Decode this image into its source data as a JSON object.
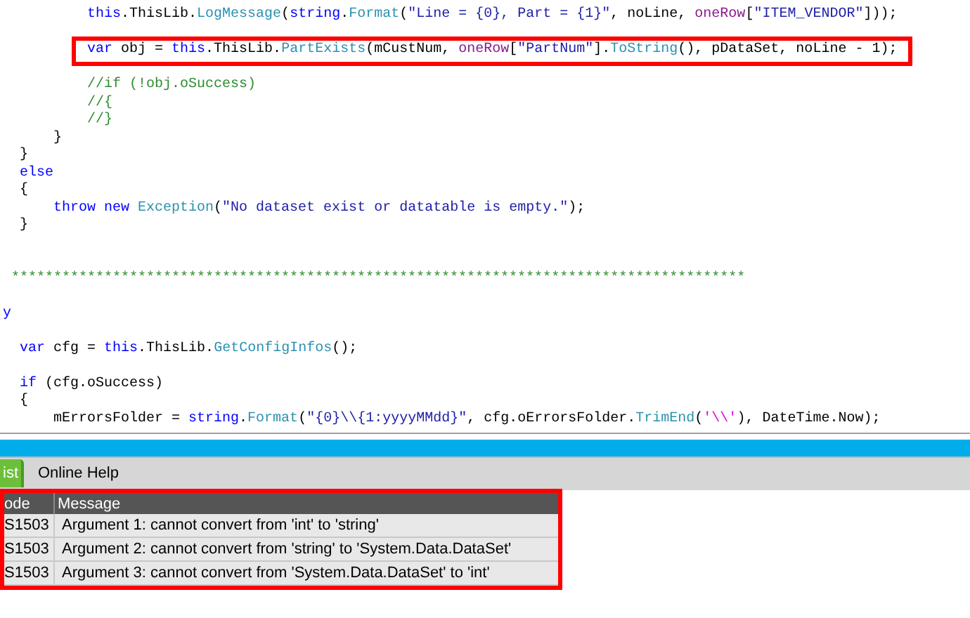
{
  "code_blocks": [
    {
      "kind": "normal",
      "lines": [
        {
          "kind": "deep",
          "highlighted": false,
          "tokens": [
            {
              "kind": "keyword",
              "text": "this"
            },
            {
              "kind": "plain",
              "text": ".ThisLib."
            },
            {
              "kind": "method",
              "text": "LogMessage"
            },
            {
              "kind": "plain",
              "text": "("
            },
            {
              "kind": "keyword",
              "text": "string"
            },
            {
              "kind": "plain",
              "text": "."
            },
            {
              "kind": "method",
              "text": "Format"
            },
            {
              "kind": "plain",
              "text": "("
            },
            {
              "kind": "string",
              "text": "\"Line = {0}, Part = {1}\""
            },
            {
              "kind": "plain",
              "text": ", noLine, "
            },
            {
              "kind": "variable",
              "text": "oneRow"
            },
            {
              "kind": "plain",
              "text": "["
            },
            {
              "kind": "string",
              "text": "\"ITEM_VENDOR\""
            },
            {
              "kind": "plain",
              "text": "]));"
            }
          ]
        }
      ]
    },
    {
      "kind": "normal",
      "lines": [
        {
          "kind": "deep",
          "highlighted": true,
          "tokens": [
            {
              "kind": "keyword",
              "text": "var"
            },
            {
              "kind": "plain",
              "text": " obj = "
            },
            {
              "kind": "keyword",
              "text": "this"
            },
            {
              "kind": "plain",
              "text": ".ThisLib."
            },
            {
              "kind": "method",
              "text": "PartExists"
            },
            {
              "kind": "plain",
              "text": "(mCustNum, "
            },
            {
              "kind": "variable",
              "text": "oneRow"
            },
            {
              "kind": "plain",
              "text": "["
            },
            {
              "kind": "string",
              "text": "\"PartNum\""
            },
            {
              "kind": "plain",
              "text": "]."
            },
            {
              "kind": "method",
              "text": "ToString"
            },
            {
              "kind": "plain",
              "text": "(), pDataSet, noLine - 1);"
            }
          ]
        }
      ]
    },
    {
      "kind": "normal",
      "lines": [
        {
          "kind": "deep",
          "highlighted": false,
          "tokens": [
            {
              "kind": "comment",
              "text": "//if (!obj.oSuccess)"
            }
          ]
        },
        {
          "kind": "deep",
          "highlighted": false,
          "tokens": [
            {
              "kind": "comment",
              "text": "//{"
            }
          ]
        },
        {
          "kind": "deep",
          "highlighted": false,
          "tokens": [
            {
              "kind": "comment",
              "text": "//}"
            }
          ]
        },
        {
          "kind": "middle",
          "highlighted": false,
          "tokens": [
            {
              "kind": "plain",
              "text": "}"
            }
          ]
        },
        {
          "kind": "shallow",
          "highlighted": false,
          "tokens": [
            {
              "kind": "plain",
              "text": "}"
            }
          ]
        },
        {
          "kind": "shallow",
          "highlighted": false,
          "tokens": [
            {
              "kind": "keyword",
              "text": "else"
            }
          ]
        },
        {
          "kind": "shallow",
          "highlighted": false,
          "tokens": [
            {
              "kind": "plain",
              "text": "{"
            }
          ]
        },
        {
          "kind": "middle",
          "highlighted": false,
          "tokens": [
            {
              "kind": "keyword",
              "text": "throw new"
            },
            {
              "kind": "method",
              "text": " Exception"
            },
            {
              "kind": "plain",
              "text": "("
            },
            {
              "kind": "string",
              "text": "\"No dataset exist or datatable is empty.\""
            },
            {
              "kind": "plain",
              "text": ");"
            }
          ]
        },
        {
          "kind": "shallow",
          "highlighted": false,
          "tokens": [
            {
              "kind": "plain",
              "text": "}"
            }
          ]
        }
      ]
    },
    {
      "kind": "banner",
      "lines": [
        {
          "kind": "edge",
          "highlighted": false,
          "tokens": [
            {
              "kind": "comment",
              "text": "***************************************************************************************"
            }
          ]
        }
      ]
    },
    {
      "kind": "normal",
      "lines": [
        {
          "kind": "flush",
          "highlighted": false,
          "tokens": [
            {
              "kind": "keyword",
              "text": "y"
            }
          ]
        }
      ]
    },
    {
      "kind": "normal",
      "lines": [
        {
          "kind": "shallow",
          "highlighted": false,
          "tokens": [
            {
              "kind": "keyword",
              "text": "var"
            },
            {
              "kind": "plain",
              "text": " cfg = "
            },
            {
              "kind": "keyword",
              "text": "this"
            },
            {
              "kind": "plain",
              "text": ".ThisLib."
            },
            {
              "kind": "method",
              "text": "GetConfigInfos"
            },
            {
              "kind": "plain",
              "text": "();"
            }
          ]
        }
      ]
    },
    {
      "kind": "normal",
      "lines": [
        {
          "kind": "shallow",
          "highlighted": false,
          "tokens": [
            {
              "kind": "keyword",
              "text": "if"
            },
            {
              "kind": "plain",
              "text": " (cfg.oSuccess)"
            }
          ]
        },
        {
          "kind": "shallow",
          "highlighted": false,
          "tokens": [
            {
              "kind": "plain",
              "text": "{"
            }
          ]
        },
        {
          "kind": "middle",
          "highlighted": false,
          "tokens": [
            {
              "kind": "plain",
              "text": "mErrorsFolder = "
            },
            {
              "kind": "keyword",
              "text": "string"
            },
            {
              "kind": "plain",
              "text": "."
            },
            {
              "kind": "method",
              "text": "Format"
            },
            {
              "kind": "plain",
              "text": "("
            },
            {
              "kind": "string",
              "text": "\"{0}\\\\{1:yyyyMMdd}\""
            },
            {
              "kind": "plain",
              "text": ", cfg.oErrorsFolder."
            },
            {
              "kind": "method",
              "text": "TrimEnd"
            },
            {
              "kind": "plain",
              "text": "("
            },
            {
              "kind": "char",
              "text": "'\\\\'"
            },
            {
              "kind": "plain",
              "text": "), DateTime.Now);"
            }
          ]
        }
      ]
    }
  ],
  "tabs": [
    {
      "label": "ist",
      "selected": true
    },
    {
      "label": "Online Help",
      "selected": false
    }
  ],
  "error_table": {
    "highlighted": true,
    "columns": [
      "ode",
      "Message"
    ],
    "rows": [
      [
        "S1503",
        "Argument 1: cannot convert from 'int' to 'string'"
      ],
      [
        "S1503",
        "Argument 2: cannot convert from 'string' to 'System.Data.DataSet'"
      ],
      [
        "S1503",
        "Argument 3: cannot convert from 'System.Data.DataSet' to 'int'"
      ]
    ]
  }
}
